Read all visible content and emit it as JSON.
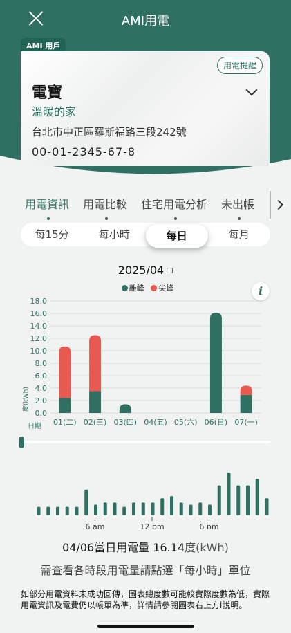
{
  "window": {
    "title": "AMI用電"
  },
  "account": {
    "tag": "AMI 用戶",
    "name": "電寶",
    "nickname": "溫暖的家",
    "address": "台北市中正區羅斯福路三段242號",
    "number": "00-01-2345-67-8",
    "remind_label": "用電提醒"
  },
  "tabs": [
    "用電資訊",
    "用電比較",
    "住宅用電分析",
    "未出帳"
  ],
  "periods": [
    "每15分",
    "每小時",
    "每日",
    "每月"
  ],
  "selected_period": "每日",
  "month_label": "2025/04",
  "legend": {
    "offpeak": "離峰",
    "peak": "尖峰"
  },
  "colors": {
    "offpeak": "#2f7063",
    "peak": "#e85a50",
    "accent": "#2f7063"
  },
  "chart_data": {
    "type": "bar",
    "stacked": true,
    "ylabel": "度(kWh)",
    "xlabel": "日期",
    "ylim": [
      0,
      18
    ],
    "yticks": [
      "0.0",
      "2.0",
      "4.0",
      "6.0",
      "8.0",
      "10.0",
      "12.0",
      "14.0",
      "16.0",
      "18.0"
    ],
    "categories": [
      "01(二)",
      "02(三)",
      "03(四)",
      "04(五)",
      "05(六)",
      "06(日)",
      "07(一)"
    ],
    "series": [
      {
        "name": "離峰",
        "values": [
          2.4,
          3.5,
          1.4,
          0,
          0,
          16.1,
          2.9
        ]
      },
      {
        "name": "尖峰",
        "values": [
          8.3,
          9.0,
          0,
          0,
          0,
          0,
          1.5
        ]
      }
    ]
  },
  "hourly_chart": {
    "type": "bar",
    "x_ticks": [
      "6 am",
      "12 pm",
      "6 pm"
    ],
    "values": [
      0.2,
      0.2,
      0.2,
      0.2,
      0.2,
      0.6,
      0.25,
      0.3,
      0.3,
      0.2,
      0.3,
      0.3,
      0.3,
      0.4,
      0.45,
      0.3,
      0.25,
      0.3,
      0.25,
      0.7,
      1.0,
      0.7,
      0.7,
      0.85,
      0.4
    ]
  },
  "summary": {
    "text": "04/06當日用電量 16.14",
    "unit_cn": "度",
    "unit": "(kWh)"
  },
  "hint": "需查看各時段用電量請點選「每小時」單位",
  "note": "如部分用電資料未成功回傳，圖表總度數可能較實際度數為低，實際用電資訊及電費仍以帳單為準，詳情請參閱圖表右上方i說明。"
}
